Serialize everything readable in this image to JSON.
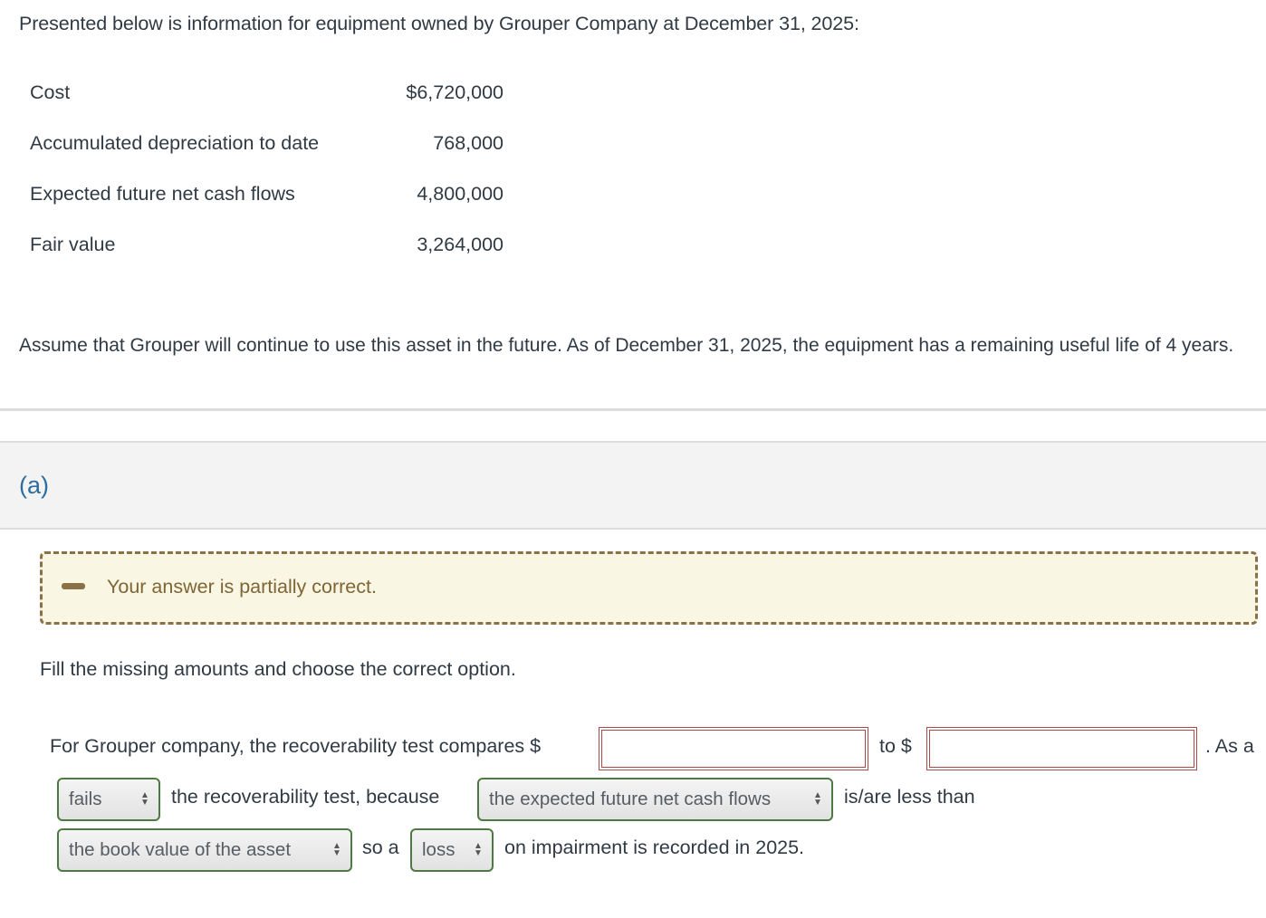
{
  "intro": "Presented below is information for equipment owned by Grouper Company at December 31, 2025:",
  "table": [
    {
      "label": "Cost",
      "value": "$6,720,000"
    },
    {
      "label": "Accumulated depreciation to date",
      "value": "768,000"
    },
    {
      "label": "Expected future net cash flows",
      "value": "4,800,000"
    },
    {
      "label": "Fair value",
      "value": "3,264,000"
    }
  ],
  "assumption": "Assume that Grouper will continue to use this asset in the future. As of December 31, 2025, the equipment has a remaining useful life of 4 years.",
  "part": {
    "label": "(a)"
  },
  "feedback": {
    "icon": "minus-icon",
    "text": "Your answer is partially correct."
  },
  "instructions": "Fill the missing amounts and choose the correct option.",
  "question": {
    "text1": "For Grouper company, the recoverability test compares $",
    "input1_value": "",
    "text2": "to $",
    "input2_value": "",
    "text3": ". As a",
    "select1": "fails",
    "text4": "the recoverability test, because",
    "select2": "the expected future net cash flows",
    "text5": "is/are less than",
    "select3": "the book value of the asset",
    "text6": "so a",
    "select4": "loss",
    "text7": "on impairment is recorded in 2025."
  }
}
